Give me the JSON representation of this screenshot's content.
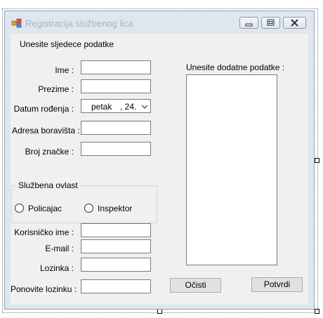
{
  "window": {
    "title": "Registracija službenog lica"
  },
  "form": {
    "header": "Unesite sljedece podatke",
    "labels": {
      "ime": "Ime :",
      "prezime": "Prezime :",
      "datum_rodjenja": "Datum rođenja :",
      "adresa": "Adresa boravišta :",
      "broj_znacke": "Broj značke :",
      "korisnicko_ime": "Korisničko ime :",
      "email": "E-mail :",
      "lozinka": "Lozinka :",
      "ponovite_lozinku": "Ponovite lozinku :"
    },
    "values": {
      "ime": "",
      "prezime": "",
      "adresa": "",
      "broj_znacke": "",
      "korisnicko_ime": "",
      "email": "",
      "lozinka": "",
      "ponovite_lozinku": ""
    },
    "date": {
      "day_name": "petak",
      "day_number": ", 24."
    },
    "ovlast": {
      "title": "Službena ovlast",
      "options": [
        "Policajac",
        "Inspektor"
      ],
      "selected": null
    },
    "extra": {
      "label": "Unesite dodatne podatke :",
      "value": ""
    },
    "buttons": {
      "clear": "Očisti",
      "confirm": "Potvrdi"
    }
  },
  "colors": {
    "frame": "#dfe6ee",
    "client": "#f0f0f0",
    "title_text_inactive": "#a7b3c0"
  }
}
